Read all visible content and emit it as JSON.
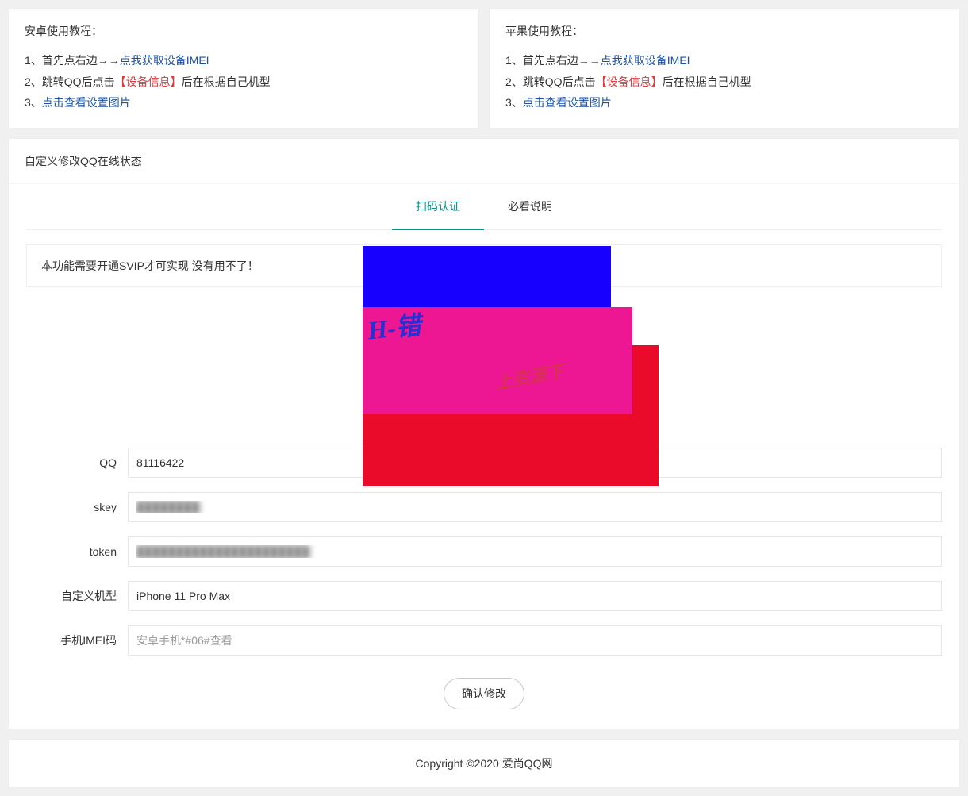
{
  "tutorials": {
    "android": {
      "title": "安卓使用教程：",
      "steps": [
        {
          "num": "1、",
          "prefix": "首先点右边→→",
          "link": "点我获取设备IMEI"
        },
        {
          "num": "2、",
          "prefix": "跳转QQ后点击",
          "highlight": "【设备信息】",
          "suffix": "后在根据自己机型"
        },
        {
          "num": "3、",
          "text": "点击查看设置图片"
        }
      ]
    },
    "apple": {
      "title": "苹果使用教程：",
      "steps": [
        {
          "num": "1、",
          "prefix": "首先点右边→→",
          "link": "点我获取设备IMEI"
        },
        {
          "num": "2、",
          "prefix": "跳转QQ后点击",
          "highlight": "【设备信息】",
          "suffix": "后在根据自己机型"
        },
        {
          "num": "3、",
          "text": "点击查看设置图片"
        }
      ]
    }
  },
  "main": {
    "title": "自定义修改QQ在线状态",
    "tabs": {
      "scan": "扫码认证",
      "info": "必看说明"
    },
    "notice": "本功能需要开通SVIP才可实现 没有用不了！",
    "overlay_text1": "H-错",
    "overlay_text2": "上资源下"
  },
  "form": {
    "labels": {
      "qq": "QQ",
      "skey": "skey",
      "token": "token",
      "model": "自定义机型",
      "imei": "手机IMEI码"
    },
    "values": {
      "qq": "81116422",
      "skey": "████████",
      "token": "██████████████████████",
      "model": "iPhone 11 Pro Max",
      "imei": ""
    },
    "placeholders": {
      "imei": "安卓手机*#06#查看"
    },
    "submit": "确认修改"
  },
  "footer": "Copyright ©2020 爱尚QQ网"
}
